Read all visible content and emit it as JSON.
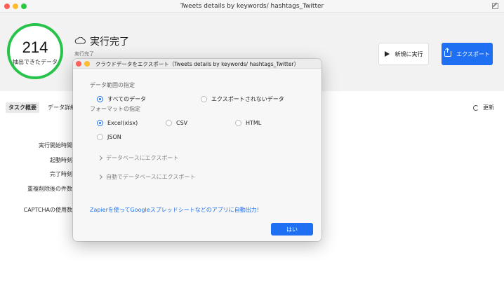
{
  "window": {
    "title": "Tweets details by keywords/ hashtags_Twitter"
  },
  "summary": {
    "count": "214",
    "count_label": "抽出できたデータ",
    "status": "実行完了",
    "status_sub": "実行完了"
  },
  "actions": {
    "new_run": "新規に実行",
    "export": "エクスポート"
  },
  "tabs": [
    {
      "label": "タスク概要",
      "active": true
    },
    {
      "label": "データ詳細",
      "active": false
    }
  ],
  "refresh_label": "更新",
  "fields": [
    "実行開始時間",
    "起動時刻",
    "完了時刻",
    "重複削除後の件数",
    "CAPTCHAの使用数"
  ],
  "modal": {
    "title": "クラウドデータをエクスポート（Tweets details by keywords/ hashtags_Twitter）",
    "range_title": "データ範囲の指定",
    "range_options": [
      {
        "label": "すべてのデータ",
        "checked": true
      },
      {
        "label": "エクスポートされないデータ",
        "checked": false
      }
    ],
    "format_title": "フォーマットの指定",
    "format_options": [
      {
        "label": "Excel(xlsx)",
        "checked": true
      },
      {
        "label": "CSV",
        "checked": false
      },
      {
        "label": "HTML",
        "checked": false
      },
      {
        "label": "JSON",
        "checked": false
      }
    ],
    "expand_db": "データベースにエクスポート",
    "expand_auto_db": "自動でデータベースにエクスポート",
    "zapier_link": "Zapierを使ってGoogleスプレッドシートなどのアプリに自動出力!",
    "ok_label": "はい"
  },
  "colors": {
    "accent": "#1f6ff2",
    "ring": "#27c34a"
  }
}
